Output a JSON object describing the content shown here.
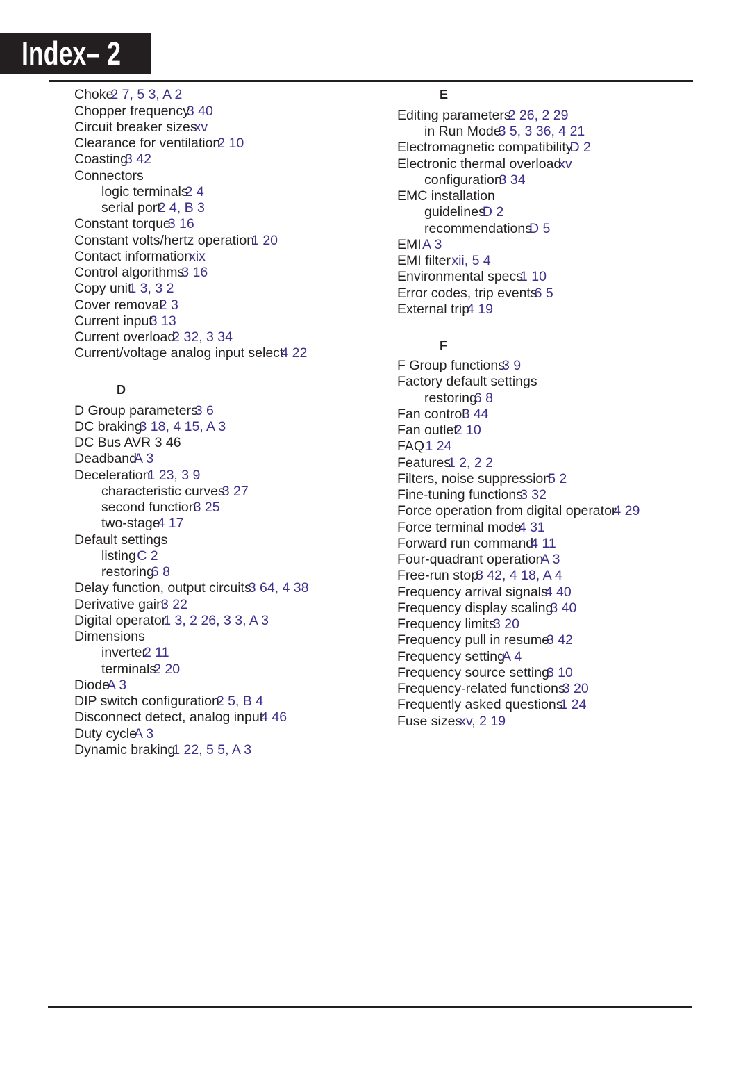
{
  "page": {
    "title": "Index– 2",
    "colors": {
      "text": "#231f20",
      "reference": "#3d2f8c",
      "title_background": "#231f20",
      "title_text": "#ffffff"
    }
  },
  "columns": [
    {
      "id": "left",
      "sections": [
        {
          "header": "",
          "entries": [
            {
              "term": "Choke",
              "refs": "2 7, 5 3, A 2",
              "level": 0
            },
            {
              "term": "Chopper frequency",
              "refs": "3 40",
              "level": 0
            },
            {
              "term": "Circuit breaker sizes",
              "refs": "xv",
              "level": 0
            },
            {
              "term": "Clearance for ventilation",
              "refs": "2 10",
              "level": 0
            },
            {
              "term": "Coasting",
              "refs": "3 42",
              "level": 0
            },
            {
              "term": "Connectors",
              "refs": "",
              "level": 0
            },
            {
              "term": "logic terminals",
              "refs": "2 4",
              "level": 1
            },
            {
              "term": "serial port",
              "refs": "2 4, B 3",
              "level": 1
            },
            {
              "term": "Constant torque",
              "refs": "3 16",
              "level": 0
            },
            {
              "term": "Constant volts/hertz operation",
              "refs": "1 20",
              "level": 0
            },
            {
              "term": "Contact information",
              "refs": "xix",
              "level": 0
            },
            {
              "term": "Control algorithms",
              "refs": "3 16",
              "level": 0
            },
            {
              "term": "Copy unit",
              "refs": "1 3, 3 2",
              "level": 0
            },
            {
              "term": "Cover removal",
              "refs": "2 3",
              "level": 0
            },
            {
              "term": "Current input",
              "refs": "3 13",
              "level": 0
            },
            {
              "term": "Current overload",
              "refs": "2 32, 3 34",
              "level": 0
            },
            {
              "term": "Current/voltage analog input select",
              "refs": "4 22",
              "level": 0
            }
          ]
        },
        {
          "header": "D",
          "entries": [
            {
              "term": "D Group parameters",
              "refs": "3 6",
              "level": 0
            },
            {
              "term": "DC braking",
              "refs": "3 18, 4 15, A 3",
              "level": 0
            },
            {
              "term": "DC Bus AVR 3 46",
              "refs": "",
              "level": 0
            },
            {
              "term": "Deadband",
              "refs": "A 3",
              "level": 0
            },
            {
              "term": "Deceleration",
              "refs": "1 23, 3 9",
              "level": 0
            },
            {
              "term": "characteristic curves",
              "refs": "3 27",
              "level": 1
            },
            {
              "term": "second function",
              "refs": "3 25",
              "level": 1
            },
            {
              "term": "two-stage",
              "refs": "4 17",
              "level": 1
            },
            {
              "term": "Default settings",
              "refs": "",
              "level": 0
            },
            {
              "term": "listing ",
              "refs": "C 2",
              "level": 1
            },
            {
              "term": "restoring",
              "refs": "6 8",
              "level": 1
            },
            {
              "term": "Delay function, output circuits",
              "refs": "3 64, 4 38",
              "level": 0
            },
            {
              "term": "Derivative gain",
              "refs": "3 22",
              "level": 0
            },
            {
              "term": "Digital operator",
              "refs": "1 3, 2 26, 3 3, A 3",
              "level": 0
            },
            {
              "term": "Dimensions",
              "refs": "",
              "level": 0
            },
            {
              "term": "inverter",
              "refs": "2 11",
              "level": 1
            },
            {
              "term": "terminals",
              "refs": "2 20",
              "level": 1
            },
            {
              "term": "Diode",
              "refs": "A 3",
              "level": 0
            },
            {
              "term": "DIP switch configuration",
              "refs": "2 5, B 4",
              "level": 0
            },
            {
              "term": "Disconnect detect, analog input",
              "refs": "4 46",
              "level": 0
            },
            {
              "term": "Duty cycle",
              "refs": "A 3",
              "level": 0
            },
            {
              "term": "Dynamic braking",
              "refs": "1 22, 5 5, A 3",
              "level": 0
            }
          ]
        }
      ]
    },
    {
      "id": "right",
      "sections": [
        {
          "header": "E",
          "entries": [
            {
              "term": "Editing parameters",
              "refs": "2 26, 2 29",
              "level": 0
            },
            {
              "term": "in Run Mode",
              "refs": "3 5, 3 36, 4 21",
              "level": 1
            },
            {
              "term": "Electromagnetic compatibility",
              "refs": "D 2",
              "level": 0
            },
            {
              "term": "Electronic thermal overload",
              "refs": "xv",
              "level": 0
            },
            {
              "term": "configuration",
              "refs": "3 34",
              "level": 1
            },
            {
              "term": "EMC installation",
              "refs": "",
              "level": 0
            },
            {
              "term": "guidelines",
              "refs": "D 2",
              "level": 1
            },
            {
              "term": "recommendations",
              "refs": "D 5",
              "level": 1
            },
            {
              "term": "EMI ",
              "refs": "A 3",
              "level": 0
            },
            {
              "term": "EMI filter ",
              "refs": "xii, 5 4",
              "level": 0
            },
            {
              "term": "Environmental specs",
              "refs": "1 10",
              "level": 0
            },
            {
              "term": "Error codes, trip events",
              "refs": "6 5",
              "level": 0
            },
            {
              "term": "External trip",
              "refs": "4 19",
              "level": 0
            }
          ]
        },
        {
          "header": "F",
          "entries": [
            {
              "term": "F Group functions",
              "refs": "3 9",
              "level": 0
            },
            {
              "term": "Factory default settings",
              "refs": "",
              "level": 0
            },
            {
              "term": "restoring",
              "refs": "6 8",
              "level": 1
            },
            {
              "term": "Fan control",
              "refs": "3 44",
              "level": 0
            },
            {
              "term": "Fan outlet",
              "refs": "2 10",
              "level": 0
            },
            {
              "term": "FAQ ",
              "refs": "1 24",
              "level": 0
            },
            {
              "term": "Features",
              "refs": "1 2, 2 2",
              "level": 0
            },
            {
              "term": "Filters, noise suppression",
              "refs": "5 2",
              "level": 0
            },
            {
              "term": "Fine-tuning functions",
              "refs": "3 32",
              "level": 0
            },
            {
              "term": "Force operation from digital operator",
              "refs": "4 29",
              "level": 0
            },
            {
              "term": "Force terminal mode",
              "refs": "4 31",
              "level": 0
            },
            {
              "term": "Forward run command",
              "refs": "4 11",
              "level": 0
            },
            {
              "term": "Four-quadrant operation",
              "refs": "A 3",
              "level": 0
            },
            {
              "term": "Free-run stop",
              "refs": "3 42, 4 18, A 4",
              "level": 0
            },
            {
              "term": "Frequency arrival signals",
              "refs": "4 40",
              "level": 0
            },
            {
              "term": "Frequency display scaling",
              "refs": "3 40",
              "level": 0
            },
            {
              "term": "Frequency limits",
              "refs": "3 20",
              "level": 0
            },
            {
              "term": "Frequency pull in resume",
              "refs": "3 42",
              "level": 0
            },
            {
              "term": "Frequency setting",
              "refs": "A 4",
              "level": 0
            },
            {
              "term": "Frequency source setting",
              "refs": "3 10",
              "level": 0
            },
            {
              "term": "Frequency-related functions",
              "refs": "3 20",
              "level": 0
            },
            {
              "term": "Frequently asked questions",
              "refs": "1 24",
              "level": 0
            },
            {
              "term": "Fuse sizes",
              "refs": "xv, 2 19",
              "level": 0
            }
          ]
        }
      ]
    }
  ]
}
